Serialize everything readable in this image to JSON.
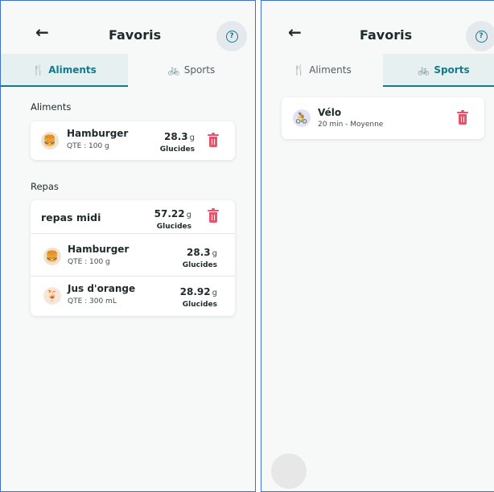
{
  "header": {
    "back_icon": "←",
    "title": "Favoris",
    "help_icon": "?"
  },
  "tabs": [
    {
      "icon": "🍴",
      "label": "Aliments"
    },
    {
      "icon": "🚲",
      "label": "Sports"
    }
  ],
  "aliments_screen": {
    "section_foods_label": "Aliments",
    "foods": [
      {
        "icon": "🍔",
        "name": "Hamburger",
        "qty": "QTE : 100 g",
        "value": "28.3",
        "unit": "g",
        "value_label": "Glucides"
      }
    ],
    "section_meals_label": "Repas",
    "meal": {
      "name": "repas midi",
      "value": "57.22",
      "unit": "g",
      "value_label": "Glucides",
      "items": [
        {
          "icon": "🍔",
          "name": "Hamburger",
          "qty": "QTE : 100 g",
          "value": "28.3",
          "unit": "g",
          "value_label": "Glucides"
        },
        {
          "icon": "🍹",
          "name": "Jus d'orange",
          "qty": "QTE : 300 mL",
          "value": "28.92",
          "unit": "g",
          "value_label": "Glucides"
        }
      ]
    }
  },
  "sports_screen": {
    "sports": [
      {
        "icon": "🚴",
        "name": "Vélo",
        "detail": "20 min - Moyenne"
      }
    ]
  },
  "colors": {
    "accent": "#137a8a",
    "delete": "#e5546b",
    "frame_border": "#3d6fd6"
  }
}
